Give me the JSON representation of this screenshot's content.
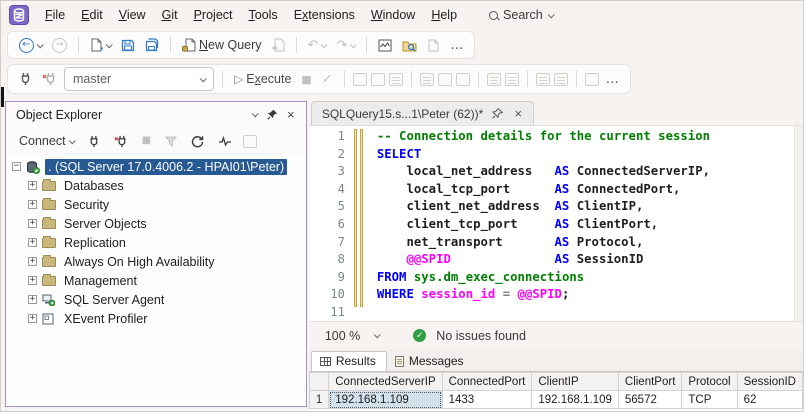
{
  "colors": {
    "accent_purple": "#7b68c8",
    "selection_blue": "#275a93",
    "keyword_blue": "#0000ff",
    "comment_green": "#008000",
    "system_magenta": "#ff00ff",
    "operator_gray": "#808080",
    "folder_gold": "#c9b77c",
    "status_green": "#2f9e44",
    "icon_blue": "#2f7acb",
    "panel_border_purple": "#a08fc9"
  },
  "menu_bar": {
    "items": [
      {
        "label": "File",
        "u": 0
      },
      {
        "label": "Edit",
        "u": 0
      },
      {
        "label": "View",
        "u": 0
      },
      {
        "label": "Git",
        "u": 0
      },
      {
        "label": "Project",
        "u": 0
      },
      {
        "label": "Tools",
        "u": 0
      },
      {
        "label": "Extensions",
        "u": 1
      },
      {
        "label": "Window",
        "u": 0
      },
      {
        "label": "Help",
        "u": 0
      }
    ],
    "search_label": "Search"
  },
  "toolbar_main": {
    "new_query_label": "New Query",
    "new_query_u": 0,
    "icons": {
      "back": "←",
      "forward": "→",
      "undo": "↶",
      "redo": "↷",
      "more": "…"
    }
  },
  "toolbar_query": {
    "database_selected": "master",
    "execute_label": "Execute",
    "execute_u": 1,
    "icons": {
      "execute_play": "▷",
      "stop": "■",
      "parse_check": "✓",
      "more": "…"
    }
  },
  "object_explorer": {
    "title": "Object Explorer",
    "connect_label": "Connect",
    "tree": {
      "root": ". (SQL Server 17.0.4006.2 - HPAI01\\Peter)",
      "children": [
        {
          "label": "Databases",
          "icon": "folder"
        },
        {
          "label": "Security",
          "icon": "folder"
        },
        {
          "label": "Server Objects",
          "icon": "folder"
        },
        {
          "label": "Replication",
          "icon": "folder"
        },
        {
          "label": "Always On High Availability",
          "icon": "folder"
        },
        {
          "label": "Management",
          "icon": "folder"
        },
        {
          "label": "SQL Server Agent",
          "icon": "agent"
        },
        {
          "label": "XEvent Profiler",
          "icon": "xevent"
        }
      ]
    }
  },
  "editor": {
    "tab_title": "SQLQuery15.s...1\\Peter (62))*",
    "zoom_level": "100 %",
    "status_message": "No issues found",
    "code_lines": [
      [
        [
          "c",
          "-- Connection details for the current session"
        ]
      ],
      [
        [
          "k",
          "SELECT"
        ]
      ],
      [
        [
          "t",
          "    local_net_address   "
        ],
        [
          "k",
          "AS"
        ],
        [
          "t",
          " ConnectedServerIP,"
        ]
      ],
      [
        [
          "t",
          "    local_tcp_port      "
        ],
        [
          "k",
          "AS"
        ],
        [
          "t",
          " ConnectedPort,"
        ]
      ],
      [
        [
          "t",
          "    client_net_address  "
        ],
        [
          "k",
          "AS"
        ],
        [
          "t",
          " ClientIP,"
        ]
      ],
      [
        [
          "t",
          "    client_tcp_port     "
        ],
        [
          "k",
          "AS"
        ],
        [
          "t",
          " ClientPort,"
        ]
      ],
      [
        [
          "t",
          "    net_transport       "
        ],
        [
          "k",
          "AS"
        ],
        [
          "t",
          " Protocol,"
        ]
      ],
      [
        [
          "t",
          "    "
        ],
        [
          "m",
          "@@SPID"
        ],
        [
          "t",
          "              "
        ],
        [
          "k",
          "AS"
        ],
        [
          "t",
          " SessionID"
        ]
      ],
      [
        [
          "k",
          "FROM"
        ],
        [
          "s",
          " sys.dm_exec_connections"
        ]
      ],
      [
        [
          "k",
          "WHERE"
        ],
        [
          "m",
          " session_id"
        ],
        [
          "g",
          " = "
        ],
        [
          "m",
          "@@SPID"
        ],
        [
          "t",
          ";"
        ]
      ],
      []
    ]
  },
  "results_panel": {
    "tabs": [
      "Results",
      "Messages"
    ],
    "grid": {
      "columns": [
        "ConnectedServerIP",
        "ConnectedPort",
        "ClientIP",
        "ClientPort",
        "Protocol",
        "SessionID"
      ],
      "row_numbers": [
        "1"
      ],
      "rows": [
        [
          "192.168.1.109",
          "1433",
          "192.168.1.109",
          "56572",
          "TCP",
          "62"
        ]
      ]
    }
  }
}
